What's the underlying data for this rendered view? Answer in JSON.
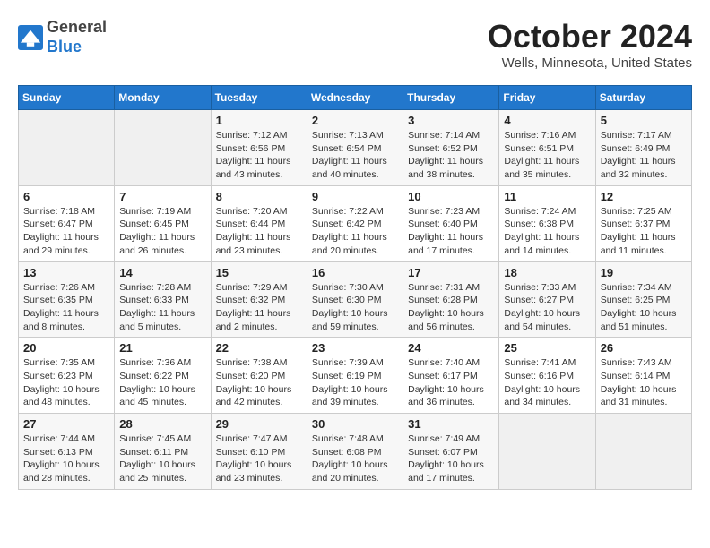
{
  "header": {
    "logo_general": "General",
    "logo_blue": "Blue",
    "month_title": "October 2024",
    "location": "Wells, Minnesota, United States"
  },
  "weekdays": [
    "Sunday",
    "Monday",
    "Tuesday",
    "Wednesday",
    "Thursday",
    "Friday",
    "Saturday"
  ],
  "weeks": [
    [
      {
        "day": "",
        "sunrise": "",
        "sunset": "",
        "daylight": ""
      },
      {
        "day": "",
        "sunrise": "",
        "sunset": "",
        "daylight": ""
      },
      {
        "day": "1",
        "sunrise": "Sunrise: 7:12 AM",
        "sunset": "Sunset: 6:56 PM",
        "daylight": "Daylight: 11 hours and 43 minutes."
      },
      {
        "day": "2",
        "sunrise": "Sunrise: 7:13 AM",
        "sunset": "Sunset: 6:54 PM",
        "daylight": "Daylight: 11 hours and 40 minutes."
      },
      {
        "day": "3",
        "sunrise": "Sunrise: 7:14 AM",
        "sunset": "Sunset: 6:52 PM",
        "daylight": "Daylight: 11 hours and 38 minutes."
      },
      {
        "day": "4",
        "sunrise": "Sunrise: 7:16 AM",
        "sunset": "Sunset: 6:51 PM",
        "daylight": "Daylight: 11 hours and 35 minutes."
      },
      {
        "day": "5",
        "sunrise": "Sunrise: 7:17 AM",
        "sunset": "Sunset: 6:49 PM",
        "daylight": "Daylight: 11 hours and 32 minutes."
      }
    ],
    [
      {
        "day": "6",
        "sunrise": "Sunrise: 7:18 AM",
        "sunset": "Sunset: 6:47 PM",
        "daylight": "Daylight: 11 hours and 29 minutes."
      },
      {
        "day": "7",
        "sunrise": "Sunrise: 7:19 AM",
        "sunset": "Sunset: 6:45 PM",
        "daylight": "Daylight: 11 hours and 26 minutes."
      },
      {
        "day": "8",
        "sunrise": "Sunrise: 7:20 AM",
        "sunset": "Sunset: 6:44 PM",
        "daylight": "Daylight: 11 hours and 23 minutes."
      },
      {
        "day": "9",
        "sunrise": "Sunrise: 7:22 AM",
        "sunset": "Sunset: 6:42 PM",
        "daylight": "Daylight: 11 hours and 20 minutes."
      },
      {
        "day": "10",
        "sunrise": "Sunrise: 7:23 AM",
        "sunset": "Sunset: 6:40 PM",
        "daylight": "Daylight: 11 hours and 17 minutes."
      },
      {
        "day": "11",
        "sunrise": "Sunrise: 7:24 AM",
        "sunset": "Sunset: 6:38 PM",
        "daylight": "Daylight: 11 hours and 14 minutes."
      },
      {
        "day": "12",
        "sunrise": "Sunrise: 7:25 AM",
        "sunset": "Sunset: 6:37 PM",
        "daylight": "Daylight: 11 hours and 11 minutes."
      }
    ],
    [
      {
        "day": "13",
        "sunrise": "Sunrise: 7:26 AM",
        "sunset": "Sunset: 6:35 PM",
        "daylight": "Daylight: 11 hours and 8 minutes."
      },
      {
        "day": "14",
        "sunrise": "Sunrise: 7:28 AM",
        "sunset": "Sunset: 6:33 PM",
        "daylight": "Daylight: 11 hours and 5 minutes."
      },
      {
        "day": "15",
        "sunrise": "Sunrise: 7:29 AM",
        "sunset": "Sunset: 6:32 PM",
        "daylight": "Daylight: 11 hours and 2 minutes."
      },
      {
        "day": "16",
        "sunrise": "Sunrise: 7:30 AM",
        "sunset": "Sunset: 6:30 PM",
        "daylight": "Daylight: 10 hours and 59 minutes."
      },
      {
        "day": "17",
        "sunrise": "Sunrise: 7:31 AM",
        "sunset": "Sunset: 6:28 PM",
        "daylight": "Daylight: 10 hours and 56 minutes."
      },
      {
        "day": "18",
        "sunrise": "Sunrise: 7:33 AM",
        "sunset": "Sunset: 6:27 PM",
        "daylight": "Daylight: 10 hours and 54 minutes."
      },
      {
        "day": "19",
        "sunrise": "Sunrise: 7:34 AM",
        "sunset": "Sunset: 6:25 PM",
        "daylight": "Daylight: 10 hours and 51 minutes."
      }
    ],
    [
      {
        "day": "20",
        "sunrise": "Sunrise: 7:35 AM",
        "sunset": "Sunset: 6:23 PM",
        "daylight": "Daylight: 10 hours and 48 minutes."
      },
      {
        "day": "21",
        "sunrise": "Sunrise: 7:36 AM",
        "sunset": "Sunset: 6:22 PM",
        "daylight": "Daylight: 10 hours and 45 minutes."
      },
      {
        "day": "22",
        "sunrise": "Sunrise: 7:38 AM",
        "sunset": "Sunset: 6:20 PM",
        "daylight": "Daylight: 10 hours and 42 minutes."
      },
      {
        "day": "23",
        "sunrise": "Sunrise: 7:39 AM",
        "sunset": "Sunset: 6:19 PM",
        "daylight": "Daylight: 10 hours and 39 minutes."
      },
      {
        "day": "24",
        "sunrise": "Sunrise: 7:40 AM",
        "sunset": "Sunset: 6:17 PM",
        "daylight": "Daylight: 10 hours and 36 minutes."
      },
      {
        "day": "25",
        "sunrise": "Sunrise: 7:41 AM",
        "sunset": "Sunset: 6:16 PM",
        "daylight": "Daylight: 10 hours and 34 minutes."
      },
      {
        "day": "26",
        "sunrise": "Sunrise: 7:43 AM",
        "sunset": "Sunset: 6:14 PM",
        "daylight": "Daylight: 10 hours and 31 minutes."
      }
    ],
    [
      {
        "day": "27",
        "sunrise": "Sunrise: 7:44 AM",
        "sunset": "Sunset: 6:13 PM",
        "daylight": "Daylight: 10 hours and 28 minutes."
      },
      {
        "day": "28",
        "sunrise": "Sunrise: 7:45 AM",
        "sunset": "Sunset: 6:11 PM",
        "daylight": "Daylight: 10 hours and 25 minutes."
      },
      {
        "day": "29",
        "sunrise": "Sunrise: 7:47 AM",
        "sunset": "Sunset: 6:10 PM",
        "daylight": "Daylight: 10 hours and 23 minutes."
      },
      {
        "day": "30",
        "sunrise": "Sunrise: 7:48 AM",
        "sunset": "Sunset: 6:08 PM",
        "daylight": "Daylight: 10 hours and 20 minutes."
      },
      {
        "day": "31",
        "sunrise": "Sunrise: 7:49 AM",
        "sunset": "Sunset: 6:07 PM",
        "daylight": "Daylight: 10 hours and 17 minutes."
      },
      {
        "day": "",
        "sunrise": "",
        "sunset": "",
        "daylight": ""
      },
      {
        "day": "",
        "sunrise": "",
        "sunset": "",
        "daylight": ""
      }
    ]
  ]
}
